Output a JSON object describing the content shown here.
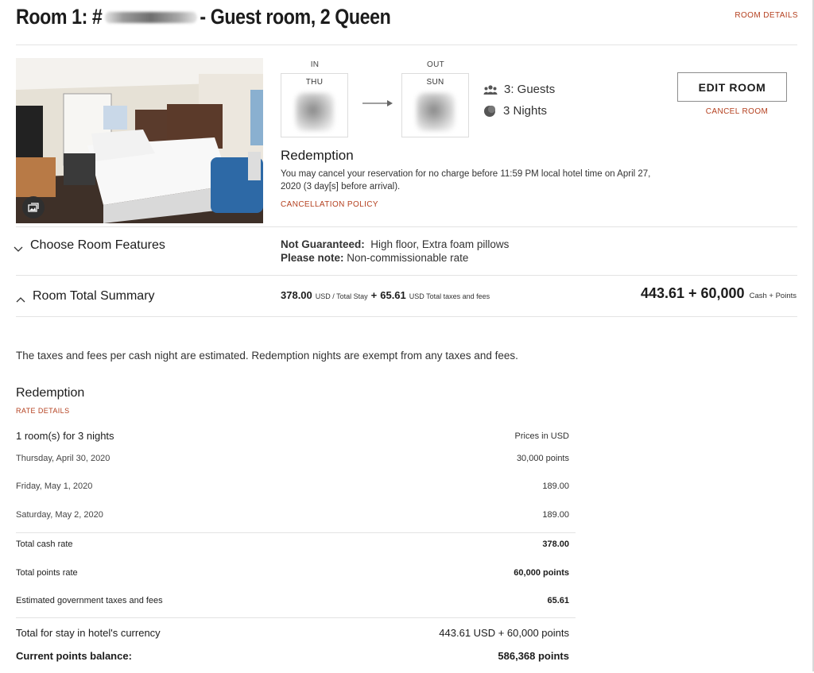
{
  "header": {
    "title_prefix": "Room 1: #",
    "title_suffix": "- Guest room, 2 Queen",
    "room_details": "ROOM DETAILS"
  },
  "stay": {
    "in_label": "IN",
    "out_label": "OUT",
    "in_day": "THU",
    "out_day": "SUN",
    "guests": "3: Guests",
    "nights": "3 Nights",
    "edit_room": "EDIT ROOM",
    "cancel_room": "CANCEL ROOM"
  },
  "redemption": {
    "title": "Redemption",
    "policy_text_1": "You may cancel your reservation for no charge before 11:59 PM local hotel time on April 27,",
    "policy_text_2": "2020 (3 day[s] before arrival).",
    "cancellation_policy": "CANCELLATION POLICY"
  },
  "features": {
    "title": "Choose Room Features",
    "not_guaranteed_label": "Not Guaranteed:",
    "not_guaranteed_value": "High floor,  Extra foam pillows",
    "please_note_label": "Please note:",
    "please_note_value": "Non-commissionable rate"
  },
  "summary": {
    "title": "Room Total Summary",
    "stay_amount": "378.00",
    "stay_unit": "USD / Total Stay",
    "plus1": "+",
    "taxes_amount": "65.61",
    "taxes_unit": "USD Total taxes and fees",
    "total_amount": "443.61",
    "plus2": "+",
    "total_points": "60,000",
    "total_unit": "Cash + Points"
  },
  "note": "The taxes and fees per cash night are estimated. Redemption nights are exempt from any taxes and fees.",
  "rate": {
    "title": "Redemption",
    "rate_details": "RATE DETAILS",
    "rooms_for_nights": "1 room(s) for 3 nights",
    "prices_in": "Prices in USD",
    "nights": [
      {
        "date": "Thursday, April 30, 2020",
        "price": "30,000 points"
      },
      {
        "date": "Friday, May 1, 2020",
        "price": "189.00"
      },
      {
        "date": "Saturday, May 2, 2020",
        "price": "189.00"
      }
    ],
    "totals": [
      {
        "label": "Total cash rate",
        "value": "378.00"
      },
      {
        "label": "Total points rate",
        "value": "60,000 points"
      },
      {
        "label": "Estimated government taxes and fees",
        "value": "65.61"
      }
    ],
    "total_stay_label": "Total for stay in hotel's currency",
    "total_stay_value": "443.61 USD + 60,000 points",
    "balance_label": "Current points balance:",
    "balance_value": "586,368 points"
  },
  "colors": {
    "accent": "#b4401f",
    "text": "#1c1c1c",
    "divider": "#e3e3e3"
  }
}
